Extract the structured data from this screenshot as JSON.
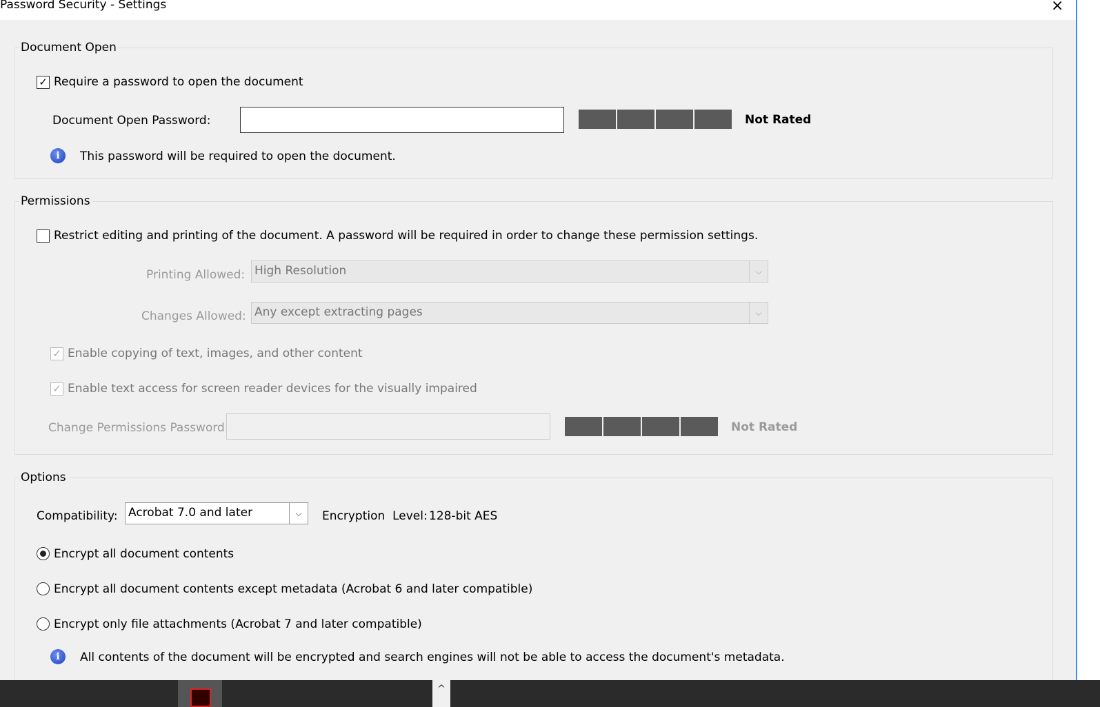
{
  "window": {
    "title": "Password Security - Settings",
    "close": "×"
  },
  "document_open": {
    "legend": "Document Open",
    "require_label": "Require a password to open the document",
    "require_checked": true,
    "password_label": "Document Open Password:",
    "password_value": "",
    "rating": "Not Rated",
    "info": "This password will be required to open the document."
  },
  "permissions": {
    "legend": "Permissions",
    "restrict_label": "Restrict editing and printing of the document. A password will be required in order to change these permission settings.",
    "restrict_checked": false,
    "printing_label": "Printing Allowed:",
    "printing_value": "High Resolution",
    "changes_label": "Changes Allowed:",
    "changes_value": "Any except extracting pages",
    "copy_label": "Enable copying of text, images, and other content",
    "screen_reader_label": "Enable text access for screen reader devices for the visually impaired",
    "password_label": "Change Permissions Password:",
    "rating": "Not Rated"
  },
  "options": {
    "legend": "Options",
    "compat_label": "Compatibility:",
    "compat_value": "Acrobat 7.0 and later",
    "enc_label": "Encryption  Level:",
    "enc_value": "128-bit AES",
    "radio1": "Encrypt all document contents",
    "radio2": "Encrypt all document contents except metadata (Acrobat 6 and later compatible)",
    "radio3": "Encrypt only file attachments (Acrobat 7 and later compatible)",
    "info": "All contents of the document will be encrypted and search engines will not be able to access the document's metadata."
  },
  "icons": {
    "check": "✓",
    "chevron": "⌵",
    "info": "i",
    "up": "^"
  }
}
